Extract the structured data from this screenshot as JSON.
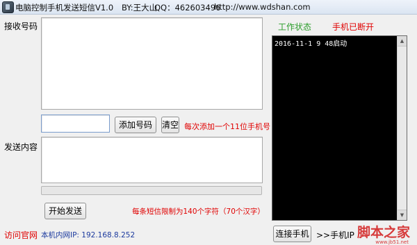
{
  "window": {
    "title": "电脑控制手机发送短信V1.0",
    "author": "BY:王大山",
    "qq": "QQ：462603496",
    "url": "http://www.wdshan.com",
    "icon": "phone-icon"
  },
  "recipients": {
    "label": "接收号码",
    "numbers_value": "",
    "number_input_value": "",
    "add_button": "添加号码",
    "clear_button": "清空",
    "hint": "每次添加一个11位手机号"
  },
  "message": {
    "label": "发送内容",
    "content_value": "",
    "progress": 0,
    "send_button": "开始发送",
    "limit_hint": "每条短信限制为140个字符（70个汉字）"
  },
  "footer": {
    "visit_site": "访问官网",
    "lan_ip": "本机内网IP: 192.168.8.252"
  },
  "status": {
    "label": "工作状态",
    "state": "手机已断开",
    "log": [
      "2016-11-1 9 48启动"
    ],
    "connect_button": "连接手机",
    "phone_ip_label": ">>手机IP"
  },
  "watermark": {
    "text": "脚本之家",
    "url": "www.jb51.net"
  },
  "colors": {
    "hint_red": "#e00000",
    "status_green": "#2a9d2a",
    "ip_blue": "#1c3a9e",
    "log_bg": "#000000"
  }
}
